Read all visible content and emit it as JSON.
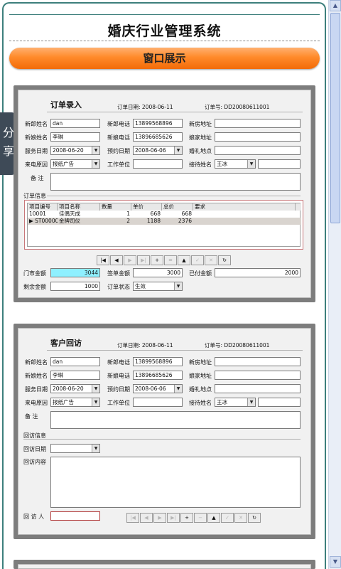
{
  "share_tab": "分享",
  "page_title": "婚庆行业管理系统",
  "section_title": "窗口展示",
  "order_panel": {
    "title": "订单录入",
    "order_date": "订单日期: 2008-06-11",
    "order_no": "订单号: DD20080611001",
    "labels": {
      "groom_name": "新郎姓名",
      "groom_phone": "新郎电话",
      "new_house": "新房地址",
      "bride_name": "新娘姓名",
      "bride_phone": "新娘电话",
      "bride_home": "娘家地址",
      "service_date": "服务日期",
      "booking_date": "预约日期",
      "wedding_place": "婚礼地点",
      "source": "来电原因",
      "work_unit": "工作单位",
      "receptionist": "接待姓名",
      "remarks": "备    注",
      "order_info": "订单信息",
      "store_amount": "门市金额",
      "contract_amount": "签单金额",
      "paid_amount": "已付金额",
      "remaining": "剩余金额",
      "status": "订单状态"
    },
    "values": {
      "groom_name": "dan",
      "groom_phone": "13899568896",
      "bride_name": "李琳",
      "bride_phone": "13896685626",
      "service_date": "2008-06-20",
      "booking_date": "2008-06-06",
      "source": "报纸广告",
      "receptionist": "王冰",
      "store_amount": "3044",
      "contract_amount": "3000",
      "paid_amount": "2000",
      "remaining": "1000",
      "status": "生效"
    },
    "grid_headers": [
      "项目编号",
      "项目名称",
      "数量",
      "单价",
      "总价",
      "要求"
    ],
    "grid_rows": [
      [
        "10001",
        "佳偶天成",
        "1",
        "668",
        "668",
        ""
      ],
      [
        "ST0000001",
        "金牌司仪",
        "2",
        "1188",
        "2376",
        ""
      ]
    ],
    "nav_buttons": [
      "|◀",
      "◀",
      "▶",
      "▶|",
      "+",
      "−",
      "▲",
      "✓",
      "✕",
      "↻"
    ]
  },
  "visit_panel": {
    "title": "客户回访",
    "order_date": "订单日期: 2008-06-11",
    "order_no": "订单号: DD20080611001",
    "labels": {
      "groom_name": "新郎姓名",
      "groom_phone": "新郎电话",
      "new_house": "新房地址",
      "bride_name": "新娘姓名",
      "bride_phone": "新娘电话",
      "bride_home": "娘家地址",
      "service_date": "服务日期",
      "booking_date": "预约日期",
      "wedding_place": "婚礼地点",
      "source": "来电原因",
      "work_unit": "工作单位",
      "receptionist": "接待姓名",
      "remarks": "备    注",
      "visit_info": "回访信息",
      "visit_date": "回访日期",
      "visit_content": "回访内容",
      "visitor": "回 访 人"
    },
    "values": {
      "groom_name": "dan",
      "groom_phone": "13899568896",
      "bride_name": "李琳",
      "bride_phone": "13896685626",
      "service_date": "2008-06-20",
      "booking_date": "2008-06-06",
      "source": "报纸广告",
      "receptionist": "王冰"
    },
    "nav_buttons": [
      "|◀",
      "◀",
      "▶",
      "▶|",
      "+",
      "−",
      "▲",
      "✓",
      "✕",
      "↻"
    ]
  },
  "colors": {
    "accent_orange": "#f26b08",
    "frame_teal": "#3d7f7c",
    "highlight_cyan": "#8ff0ff"
  }
}
